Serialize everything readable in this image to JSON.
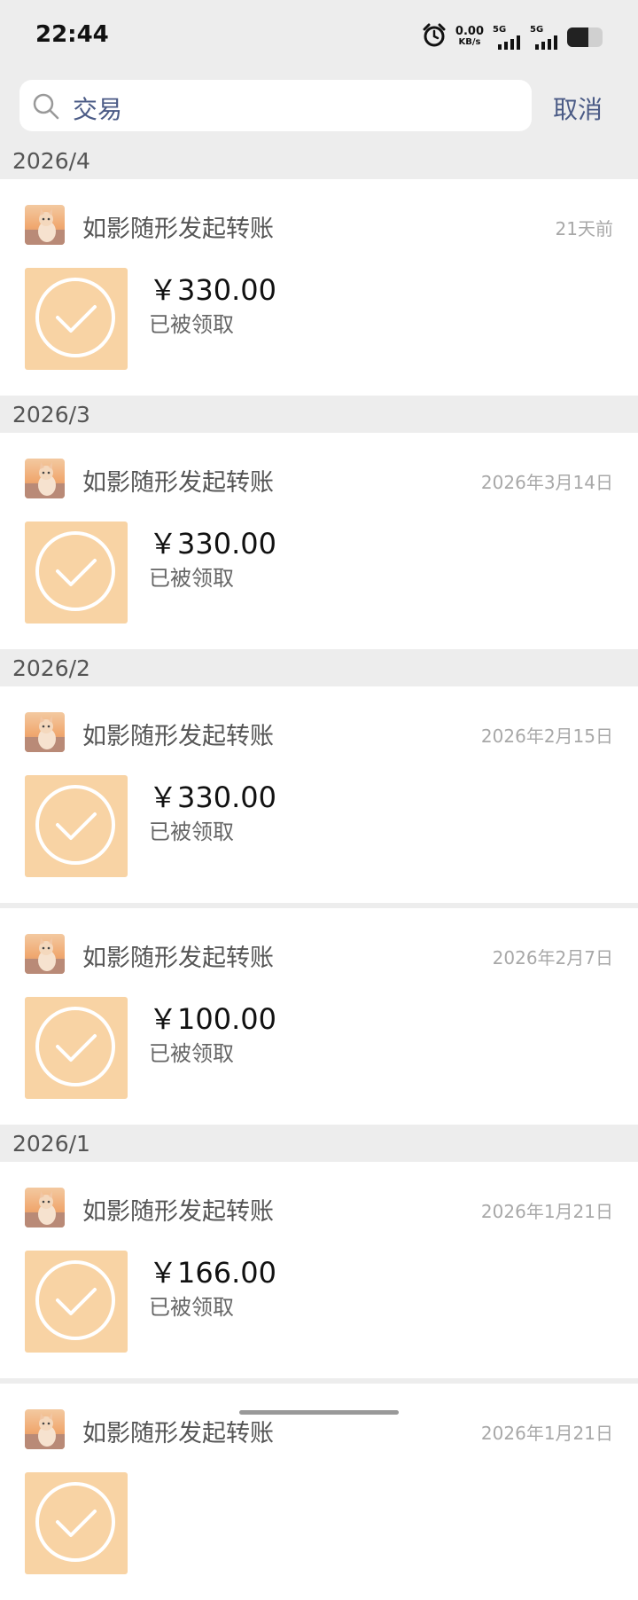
{
  "status_bar": {
    "time": "22:44",
    "net_speed_value": "0.00",
    "net_speed_unit": "KB/s",
    "sim1_label": "5G",
    "sim2_label": "5G",
    "battery_level": 0.6
  },
  "search": {
    "query": "交易",
    "cancel_label": "取消"
  },
  "months": [
    {
      "label": "2026/4",
      "entries": [
        {
          "title": "如影随形发起转账",
          "date": "21天前",
          "amount": "￥330.00",
          "status": "已被领取"
        }
      ]
    },
    {
      "label": "2026/3",
      "entries": [
        {
          "title": "如影随形发起转账",
          "date": "2026年3月14日",
          "amount": "￥330.00",
          "status": "已被领取"
        }
      ]
    },
    {
      "label": "2026/2",
      "entries": [
        {
          "title": "如影随形发起转账",
          "date": "2026年2月15日",
          "amount": "￥330.00",
          "status": "已被领取"
        },
        {
          "title": "如影随形发起转账",
          "date": "2026年2月7日",
          "amount": "￥100.00",
          "status": "已被领取"
        }
      ]
    },
    {
      "label": "2026/1",
      "entries": [
        {
          "title": "如影随形发起转账",
          "date": "2026年1月21日",
          "amount": "￥166.00",
          "status": "已被领取"
        },
        {
          "title": "如影随形发起转账",
          "date": "2026年1月21日",
          "amount": "",
          "status": ""
        }
      ]
    }
  ]
}
